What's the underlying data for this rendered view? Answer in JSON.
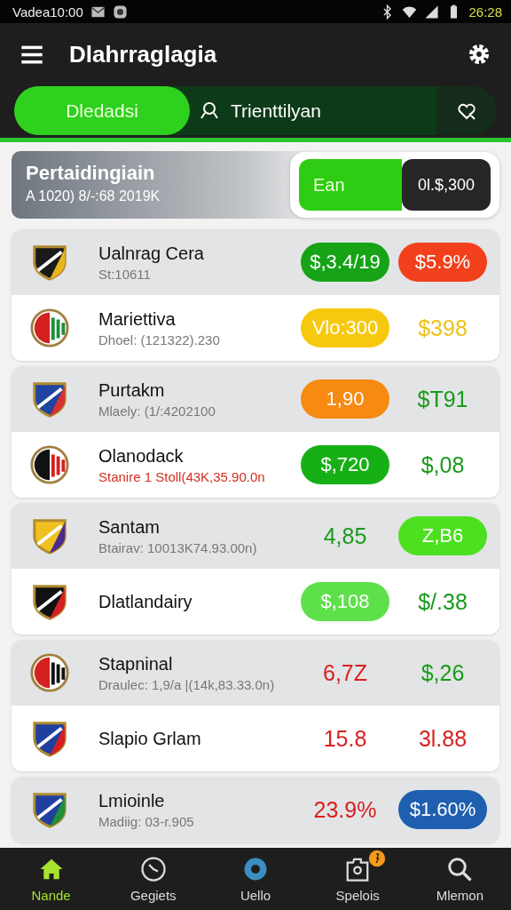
{
  "status_bar": {
    "left_text": "Vadea10:00",
    "time": "26:28"
  },
  "app_bar": {
    "title": "Dlahrraglagia"
  },
  "tabs": [
    {
      "label": "Dledadsi",
      "selected": true,
      "kind": "text"
    },
    {
      "label": "Trienttilyan",
      "selected": false,
      "kind": "search"
    },
    {
      "selected": false,
      "kind": "favorite"
    }
  ],
  "summary": {
    "title": "Pertaidingiain",
    "subtitle": "A 1020) 8/-:68 2019K",
    "toggle_label": "Ean",
    "toggle_value": "0l.$,300"
  },
  "groups": [
    {
      "rows": [
        {
          "name": "Ualnrag Cera",
          "detail": {
            "text": "St:10611",
            "color": "#777777"
          },
          "shaded": true,
          "odds": [
            {
              "text": "$,3.4/19",
              "kind": "pill",
              "color": "#16a316"
            },
            {
              "text": "$5.9%",
              "kind": "pill",
              "color": "#f2401c"
            }
          ]
        },
        {
          "name": "Mariettiva",
          "detail": {
            "text": "Dhoel: (121322).230",
            "color": "#777777"
          },
          "shaded": false,
          "odds": [
            {
              "text": "Vlo:300",
              "kind": "pill",
              "color": "#f7c90e"
            },
            {
              "text": "$398",
              "kind": "plain",
              "color": "#ecc21a"
            }
          ]
        }
      ]
    },
    {
      "rows": [
        {
          "name": "Purtakm",
          "detail": {
            "text": "Mlaely: (1/:4202100",
            "color": "#777777"
          },
          "shaded": true,
          "odds": [
            {
              "text": "1,90",
              "kind": "pill",
              "color": "#f78a10"
            },
            {
              "text": "$T91",
              "kind": "plain",
              "color": "#1a9a1a"
            }
          ]
        },
        {
          "name": "Olanodack",
          "detail": {
            "text": "Stanire 1 Stoll(43K,35.90.0n",
            "color": "#d03020"
          },
          "shaded": false,
          "odds": [
            {
              "text": "$,720",
              "kind": "pill",
              "color": "#16b016"
            },
            {
              "text": "$,08",
              "kind": "plain",
              "color": "#1a9a1a"
            }
          ]
        }
      ]
    },
    {
      "rows": [
        {
          "name": "Santam",
          "detail": {
            "text": "Btairav: 10013K74.93.00n)",
            "color": "#777777"
          },
          "shaded": true,
          "odds": [
            {
              "text": "4,85",
              "kind": "plain",
              "color": "#1a9a1a"
            },
            {
              "text": "Z,B6",
              "kind": "pill",
              "color": "#4ce020"
            }
          ]
        },
        {
          "name": "Dlatlandairy",
          "shaded": false,
          "odds": [
            {
              "text": "$,108",
              "kind": "pill",
              "color": "#5ee04a"
            },
            {
              "text": "$/.38",
              "kind": "plain",
              "color": "#1a9a1a"
            }
          ]
        }
      ]
    },
    {
      "rows": [
        {
          "name": "Stapninal",
          "detail": {
            "text": "Draulec: 1,9/a |(14k,83.33.0n)",
            "color": "#777777"
          },
          "shaded": true,
          "odds": [
            {
              "text": "6,7Z",
              "kind": "plain",
              "color": "#d82020"
            },
            {
              "text": "$,26",
              "kind": "plain",
              "color": "#1a9a1a"
            }
          ]
        },
        {
          "name": "Slapio Grlam",
          "shaded": false,
          "odds": [
            {
              "text": "15.8",
              "kind": "plain",
              "color": "#d82020"
            },
            {
              "text": "3l.88",
              "kind": "plain",
              "color": "#d82020"
            }
          ]
        }
      ]
    },
    {
      "rows": [
        {
          "name": "Lmioinle",
          "detail": {
            "text": "Madiig: 03-r.905",
            "color": "#777777"
          },
          "shaded": true,
          "odds": [
            {
              "text": "23.9%",
              "kind": "plain",
              "color": "#d82020"
            },
            {
              "text": "$1.60%",
              "kind": "pill",
              "color": "#1f5fb0"
            }
          ]
        }
      ]
    }
  ],
  "bottom_nav": [
    {
      "label": "Nande",
      "selected": true,
      "badge": false
    },
    {
      "label": "Gegiets",
      "selected": false,
      "badge": false
    },
    {
      "label": "Uello",
      "selected": false,
      "badge": false
    },
    {
      "label": "Spelois",
      "selected": false,
      "badge": true
    },
    {
      "label": "Mlemon",
      "selected": false,
      "badge": false
    }
  ]
}
